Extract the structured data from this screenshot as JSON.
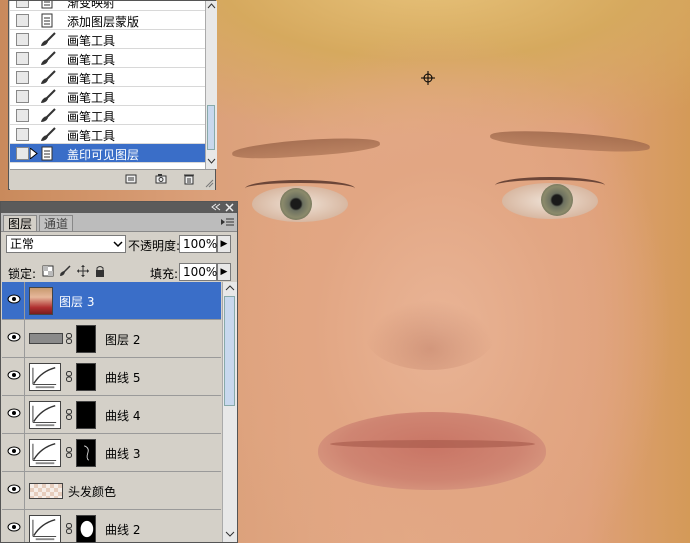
{
  "history_panel": {
    "items": [
      {
        "label": "渐变映射",
        "icon": "document-icon"
      },
      {
        "label": "添加图层蒙版",
        "icon": "document-icon"
      },
      {
        "label": "画笔工具",
        "icon": "brush-icon"
      },
      {
        "label": "画笔工具",
        "icon": "brush-icon"
      },
      {
        "label": "画笔工具",
        "icon": "brush-icon"
      },
      {
        "label": "画笔工具",
        "icon": "brush-icon"
      },
      {
        "label": "画笔工具",
        "icon": "brush-icon"
      },
      {
        "label": "画笔工具",
        "icon": "brush-icon"
      },
      {
        "label": "盖印可见图层",
        "icon": "document-icon",
        "selected": true
      }
    ]
  },
  "layers_panel": {
    "tabs": [
      "图层",
      "通道"
    ],
    "blend_mode": "正常",
    "opacity_label": "不透明度:",
    "opacity_value": "100%",
    "lock_label": "锁定:",
    "fill_label": "填充:",
    "fill_value": "100%",
    "layers": [
      {
        "name": "图层 3",
        "selected": true,
        "thumb": "photo"
      },
      {
        "name": "图层 2",
        "thumb": "gray",
        "mask": true
      },
      {
        "name": "曲线 5",
        "thumb": "curves",
        "mask": true
      },
      {
        "name": "曲线 4",
        "thumb": "curves",
        "mask": true
      },
      {
        "name": "曲线 3",
        "thumb": "curves",
        "mask": true
      },
      {
        "name": "头发颜色",
        "thumb": "transparent"
      },
      {
        "name": "曲线 2",
        "thumb": "curves",
        "mask": true
      }
    ]
  },
  "colors": {
    "selection": "#3a6ec8",
    "panel_bg": "#d4d0c8"
  }
}
